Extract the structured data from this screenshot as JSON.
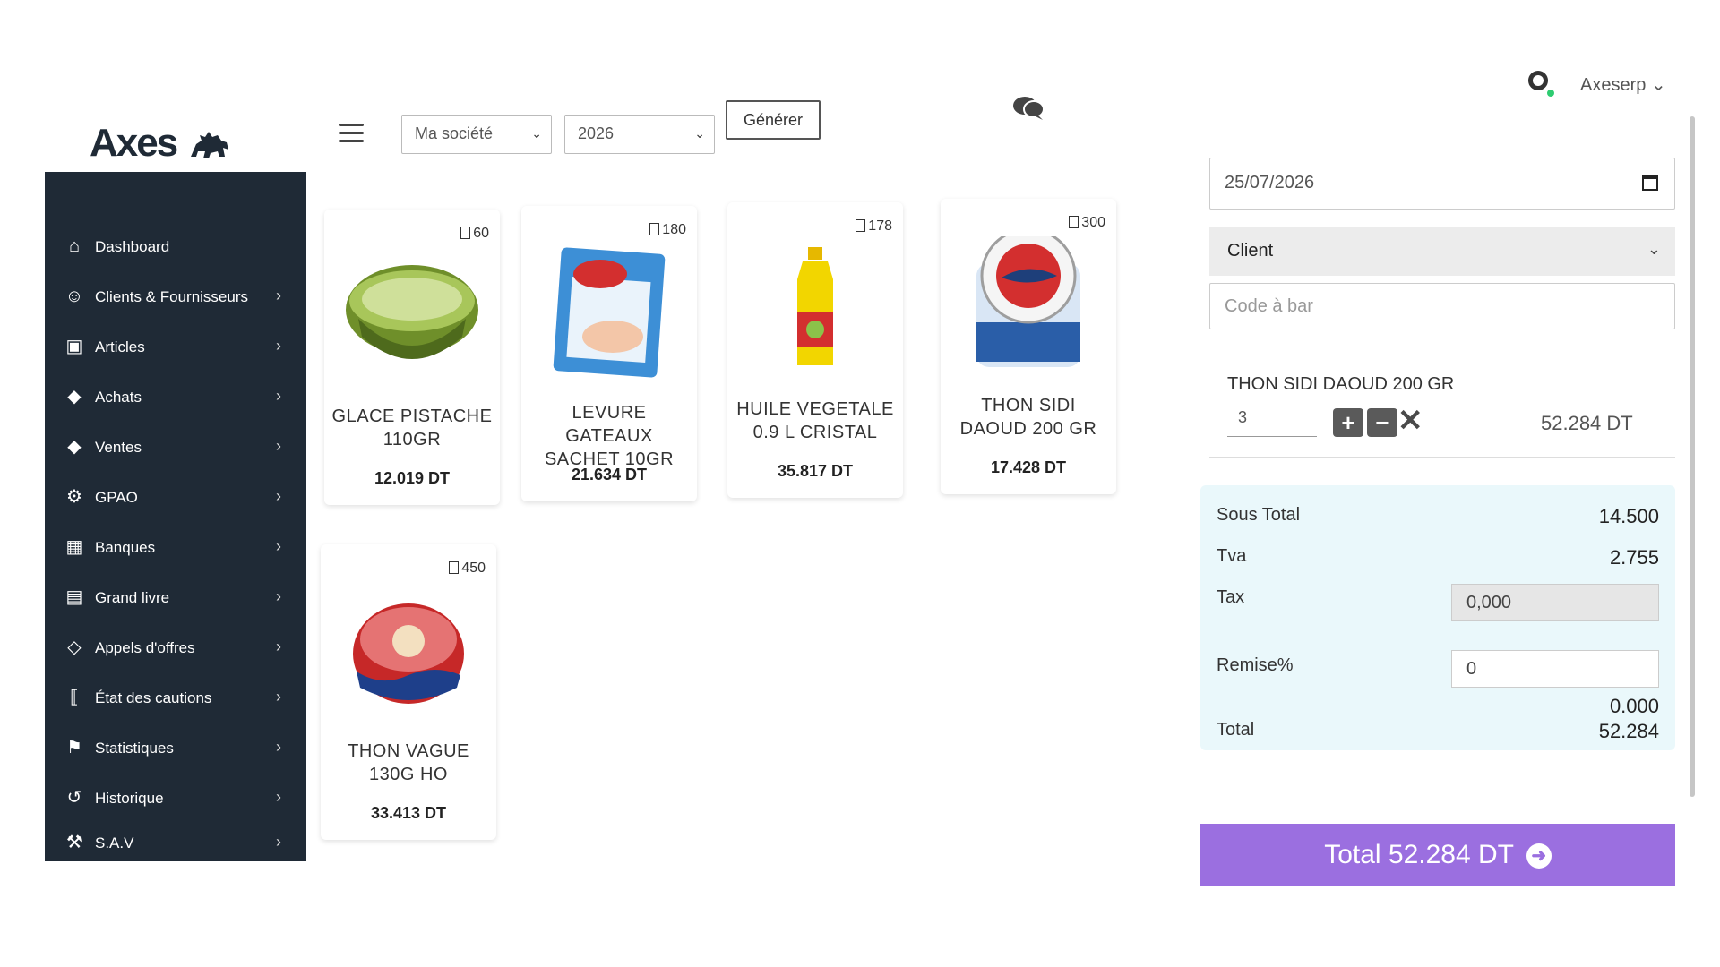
{
  "header": {
    "logo_text": "Axes",
    "company_select": "Ma société",
    "year_select": "2026",
    "generate_label": "Générer",
    "user_name": "Axeserp"
  },
  "sidebar": {
    "items": [
      {
        "label": "Dashboard",
        "icon": "home-icon"
      },
      {
        "label": "Clients & Fournisseurs",
        "icon": "user-icon"
      },
      {
        "label": "Articles",
        "icon": "box-icon"
      },
      {
        "label": "Achats",
        "icon": "tag-icon"
      },
      {
        "label": "Ventes",
        "icon": "tag-icon"
      },
      {
        "label": "GPAO",
        "icon": "gear-icon"
      },
      {
        "label": "Banques",
        "icon": "building-icon"
      },
      {
        "label": "Grand livre",
        "icon": "book-icon"
      },
      {
        "label": "Appels d'offres",
        "icon": "diamond-icon"
      },
      {
        "label": "État des cautions",
        "icon": "bracket-icon"
      },
      {
        "label": "Statistiques",
        "icon": "flag-icon"
      },
      {
        "label": "Historique",
        "icon": "history-icon"
      },
      {
        "label": "S.A.V",
        "icon": "wrench-icon"
      }
    ]
  },
  "products": [
    {
      "name": "GLACE PISTACHE 110GR",
      "price": "12.019 DT",
      "stock": "60"
    },
    {
      "name": "LEVURE GATEAUX SACHET 10GR",
      "price": "21.634 DT",
      "stock": "180"
    },
    {
      "name": "HUILE VEGETALE 0.9 L CRISTAL",
      "price": "35.817 DT",
      "stock": "178"
    },
    {
      "name": "THON SIDI DAOUD 200 GR",
      "price": "17.428 DT",
      "stock": "300"
    },
    {
      "name": "THON VAGUE 130G HO",
      "price": "33.413 DT",
      "stock": "450"
    }
  ],
  "order": {
    "date": "25/07/2026",
    "client_select": "Client",
    "barcode_placeholder": "Code à bar",
    "line": {
      "name": "THON SIDI DAOUD 200 GR",
      "qty": "3",
      "total": "52.284 DT"
    },
    "summary": {
      "sous_total_label": "Sous Total",
      "sous_total": "14.500",
      "tva_label": "Tva",
      "tva": "2.755",
      "tax_label": "Tax",
      "tax": "0,000",
      "remise_label": "Remise%",
      "remise": "0",
      "remise_amount": "0.000",
      "total_label": "Total",
      "total": "52.284"
    },
    "total_button": "Total 52.284 DT"
  },
  "colors": {
    "sidebar_bg": "#1f2a36",
    "accent_button": "#9b6fe0",
    "summary_bg": "#eaf8fb"
  }
}
